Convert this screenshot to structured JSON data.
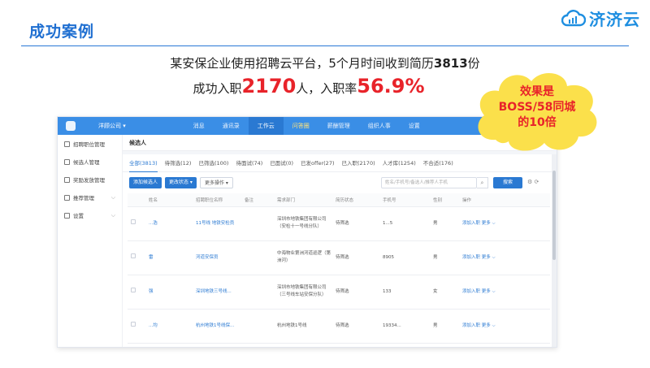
{
  "slide": {
    "title": "成功案例",
    "logo_text": "济济云"
  },
  "headline": {
    "line1_a": "某安保企业使用招聘云平台，5个月时间收到简历",
    "line1_b": "3813",
    "line1_c": "份",
    "line2_a": "成功入职",
    "line2_b": "2170",
    "line2_c": "人，入职率",
    "line2_d": "56.9%"
  },
  "badge": {
    "line1": "效果是",
    "line2": "BOSS/58同城",
    "line3": "的10倍"
  },
  "app": {
    "company": "洋顾公司 ▾",
    "menu": [
      {
        "label": "消息"
      },
      {
        "label": "通讯录"
      },
      {
        "label": "工作云"
      },
      {
        "label": "问答圈"
      },
      {
        "label": "薪酬管理"
      },
      {
        "label": "组织人事"
      },
      {
        "label": "设置"
      }
    ],
    "sidebar": [
      {
        "label": "招聘职位管理"
      },
      {
        "label": "候选人管理"
      },
      {
        "label": "奖励发放管理"
      },
      {
        "label": "推荐管理"
      },
      {
        "label": "设置"
      }
    ],
    "page_title": "候选人",
    "tabs": [
      {
        "label": "全部(3813)"
      },
      {
        "label": "待筛选(12)"
      },
      {
        "label": "已筛选(100)"
      },
      {
        "label": "待面试(74)"
      },
      {
        "label": "已面试(0)"
      },
      {
        "label": "已发offer(27)"
      },
      {
        "label": "已入职(2170)"
      },
      {
        "label": "人才库(1254)"
      },
      {
        "label": "不合适(176)"
      }
    ],
    "toolbar": {
      "add": "添加候选人",
      "status": "更改状态 ▾",
      "more": "更多操作 ▾",
      "search_placeholder": "姓名/手机号/备选人/推荐人手机",
      "search_icon": "⌕",
      "query": "搜索",
      "icons": "⚙  ⟳"
    },
    "columns": [
      "",
      "姓名",
      "招聘职位名称",
      "备注",
      "需求部门",
      "简历状态",
      "手机号",
      "性别",
      "操作"
    ],
    "rows": [
      {
        "name": "...浩",
        "position": "11号线 地铁安检员",
        "note": "",
        "dept": "深圳市地铁集团有限公司（安检十一号线分队）",
        "status": "待筛选",
        "phone": "1...5",
        "gender": "男",
        "ops": "添加入职  更多 ⌵"
      },
      {
        "name": "雷",
        "position": "河道安保员",
        "note": "",
        "dept": "中海物业第洲河道巡逻（第洲河）",
        "status": "待筛选",
        "phone": "8905",
        "gender": "男",
        "ops": "添加入职  更多 ⌵"
      },
      {
        "name": "强",
        "position": "深圳地铁三号线...",
        "note": "",
        "dept": "深圳市地铁集团有限公司（三号线车站安保分队）",
        "status": "待筛选",
        "phone": "133",
        "gender": "女",
        "ops": "添加入职  更多 ⌵"
      },
      {
        "name": "...均",
        "position": "杭州地铁1号线保...",
        "note": "",
        "dept": "杭州地铁1号线",
        "status": "待筛选",
        "phone": "19334...",
        "gender": "男",
        "ops": "添加入职  更多 ⌵"
      }
    ]
  },
  "colors": {
    "accent": "#2a79d2",
    "highlight_red": "#e8232a",
    "badge_yellow": "#fbe04b"
  }
}
